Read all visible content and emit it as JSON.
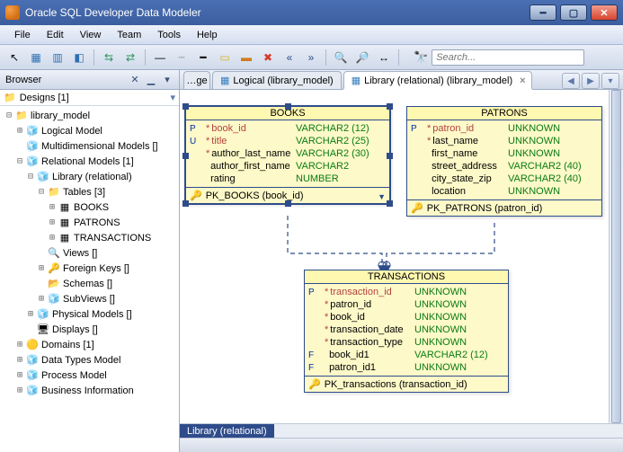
{
  "window": {
    "title": "Oracle SQL Developer Data Modeler"
  },
  "menubar": [
    "File",
    "Edit",
    "View",
    "Team",
    "Tools",
    "Help"
  ],
  "toolbar": {
    "search_placeholder": "Search..."
  },
  "browser": {
    "title": "Browser",
    "designs_label": "Designs [1]",
    "nodes": [
      {
        "d": 0,
        "tw": "⊟",
        "icon": "📁",
        "label": "library_model"
      },
      {
        "d": 1,
        "tw": "⊞",
        "icon": "🧊",
        "label": "Logical Model"
      },
      {
        "d": 1,
        "tw": "",
        "icon": "🧊",
        "label": "Multidimensional Models []"
      },
      {
        "d": 1,
        "tw": "⊟",
        "icon": "🧊",
        "label": "Relational Models [1]"
      },
      {
        "d": 2,
        "tw": "⊟",
        "icon": "🧊",
        "label": "Library (relational)"
      },
      {
        "d": 3,
        "tw": "⊟",
        "icon": "📁",
        "label": "Tables [3]"
      },
      {
        "d": 4,
        "tw": "⊞",
        "icon": "▦",
        "label": "BOOKS"
      },
      {
        "d": 4,
        "tw": "⊞",
        "icon": "▦",
        "label": "PATRONS"
      },
      {
        "d": 4,
        "tw": "⊞",
        "icon": "▦",
        "label": "TRANSACTIONS"
      },
      {
        "d": 3,
        "tw": "",
        "icon": "🔍",
        "label": "Views []"
      },
      {
        "d": 3,
        "tw": "⊞",
        "icon": "🔑",
        "label": "Foreign Keys []"
      },
      {
        "d": 3,
        "tw": "",
        "icon": "📂",
        "label": "Schemas []"
      },
      {
        "d": 3,
        "tw": "⊞",
        "icon": "🧊",
        "label": "SubViews []"
      },
      {
        "d": 2,
        "tw": "⊞",
        "icon": "🧊",
        "label": "Physical Models []"
      },
      {
        "d": 2,
        "tw": "",
        "icon": "🖥",
        "label": "Displays []"
      },
      {
        "d": 1,
        "tw": "⊞",
        "icon": "🟡",
        "label": "Domains [1]"
      },
      {
        "d": 1,
        "tw": "⊞",
        "icon": "🧊",
        "label": "Data Types Model"
      },
      {
        "d": 1,
        "tw": "⊞",
        "icon": "🧊",
        "label": "Process Model"
      },
      {
        "d": 1,
        "tw": "⊞",
        "icon": "🧊",
        "label": "Business Information"
      }
    ]
  },
  "tabs": {
    "left_overflow": "…ge",
    "logical": "Logical (library_model)",
    "library": "Library (relational) (library_model)",
    "bottom_tab": "Library (relational)"
  },
  "entities": {
    "books": {
      "title": "BOOKS",
      "cols": [
        {
          "flags": "P",
          "star": true,
          "red": true,
          "name": "book_id",
          "type": "VARCHAR2 (12)"
        },
        {
          "flags": "U",
          "star": true,
          "red": true,
          "name": "title",
          "type": "VARCHAR2 (25)"
        },
        {
          "flags": "",
          "star": true,
          "red": false,
          "name": "author_last_name",
          "type": "VARCHAR2 (30)"
        },
        {
          "flags": "",
          "star": false,
          "red": false,
          "name": "author_first_name",
          "type": "VARCHAR2"
        },
        {
          "flags": "",
          "star": false,
          "red": false,
          "name": "rating",
          "type": "NUMBER"
        }
      ],
      "pk": "PK_BOOKS (book_id)"
    },
    "patrons": {
      "title": "PATRONS",
      "cols": [
        {
          "flags": "P",
          "star": true,
          "red": true,
          "name": "patron_id",
          "type": "UNKNOWN"
        },
        {
          "flags": "",
          "star": true,
          "red": false,
          "name": "last_name",
          "type": "UNKNOWN"
        },
        {
          "flags": "",
          "star": false,
          "red": false,
          "name": "first_name",
          "type": "UNKNOWN"
        },
        {
          "flags": "",
          "star": false,
          "red": false,
          "name": "street_address",
          "type": "VARCHAR2 (40)"
        },
        {
          "flags": "",
          "star": false,
          "red": false,
          "name": "city_state_zip",
          "type": "VARCHAR2 (40)"
        },
        {
          "flags": "",
          "star": false,
          "red": false,
          "name": "location",
          "type": "UNKNOWN"
        }
      ],
      "pk": "PK_PATRONS (patron_id)"
    },
    "transactions": {
      "title": "TRANSACTIONS",
      "cols": [
        {
          "flags": "P",
          "star": true,
          "red": true,
          "name": "transaction_id",
          "type": "UNKNOWN"
        },
        {
          "flags": "",
          "star": true,
          "red": false,
          "name": "patron_id",
          "type": "UNKNOWN"
        },
        {
          "flags": "",
          "star": true,
          "red": false,
          "name": "book_id",
          "type": "UNKNOWN"
        },
        {
          "flags": "",
          "star": true,
          "red": false,
          "name": "transaction_date",
          "type": "UNKNOWN"
        },
        {
          "flags": "",
          "star": true,
          "red": false,
          "name": "transaction_type",
          "type": "UNKNOWN"
        },
        {
          "flags": "F",
          "star": false,
          "red": false,
          "name": "book_id1",
          "type": "VARCHAR2 (12)"
        },
        {
          "flags": "F",
          "star": false,
          "red": false,
          "name": "patron_id1",
          "type": "UNKNOWN"
        }
      ],
      "pk": "PK_transactions (transaction_id)"
    }
  }
}
